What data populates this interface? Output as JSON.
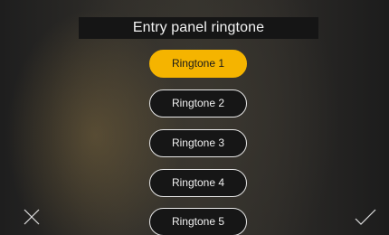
{
  "header": {
    "title": "Entry panel ringtone"
  },
  "ringtones": {
    "selected_index": 0,
    "items": [
      {
        "label": "Ringtone 1"
      },
      {
        "label": "Ringtone 2"
      },
      {
        "label": "Ringtone 3"
      },
      {
        "label": "Ringtone 4"
      },
      {
        "label": "Ringtone 5"
      }
    ]
  },
  "footer": {
    "cancel_icon": "close-icon",
    "confirm_icon": "checkmark-icon"
  },
  "colors": {
    "accent": "#f5b400",
    "button_border": "#e8e8e8",
    "button_bg": "#161616",
    "title_bg": "#151515"
  }
}
